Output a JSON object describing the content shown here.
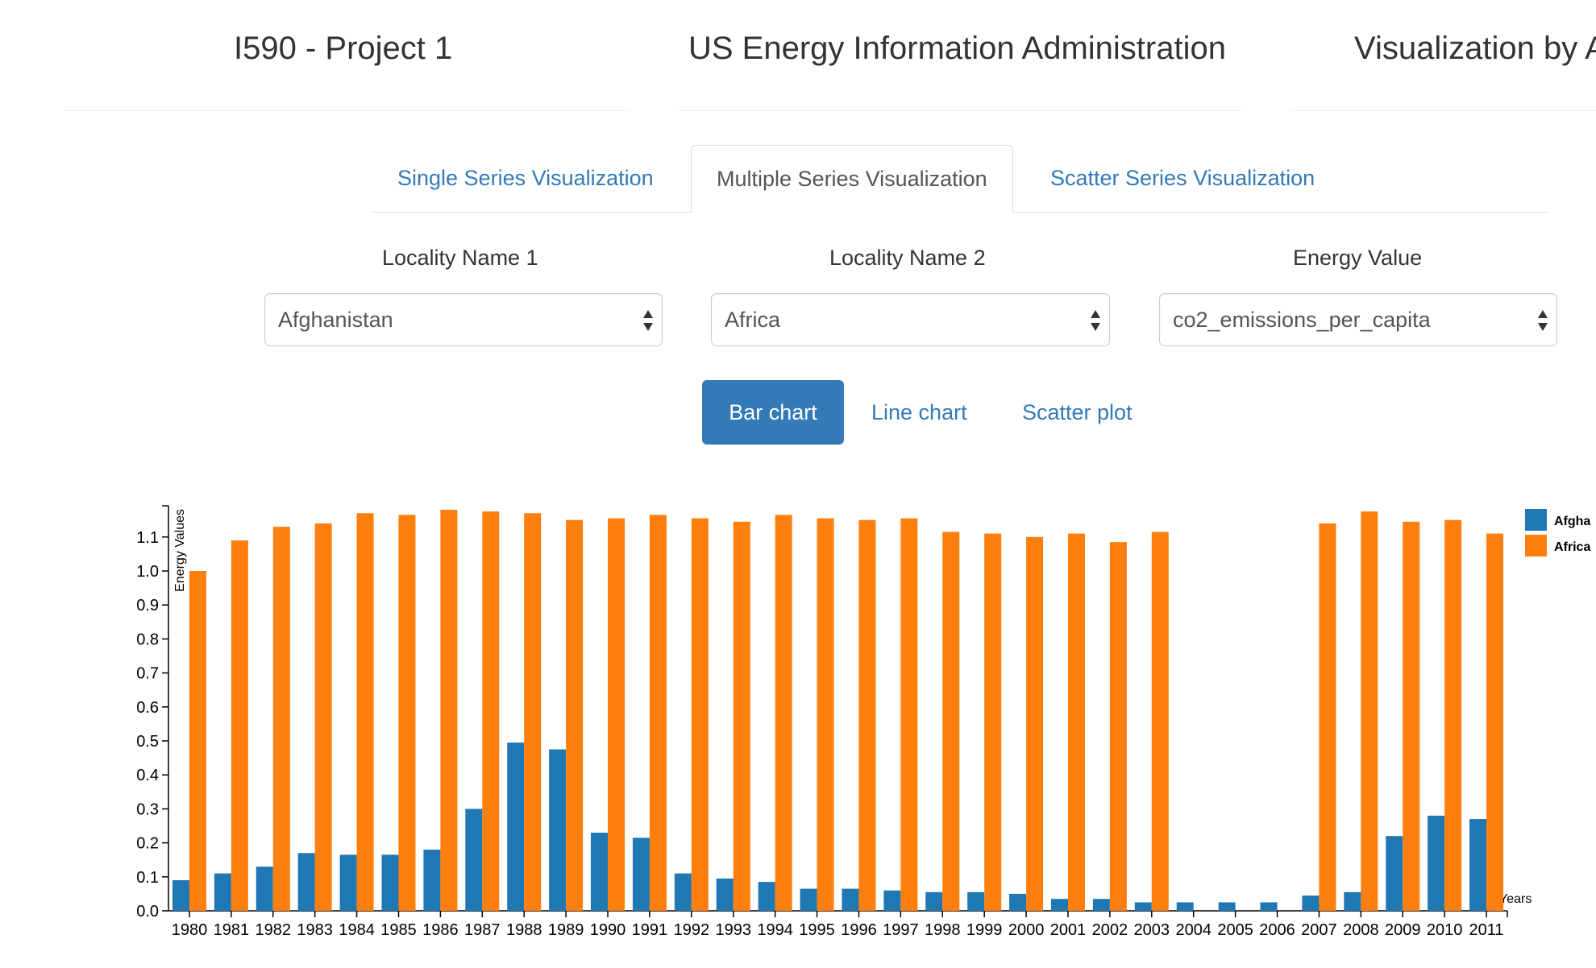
{
  "header": {
    "title_left": "I590 - Project 1",
    "title_center": "US Energy Information Administration",
    "title_right": "Visualization by A"
  },
  "tabs": [
    {
      "label": "Single Series Visualization",
      "active": false
    },
    {
      "label": "Multiple Series Visualization",
      "active": true
    },
    {
      "label": "Scatter Series Visualization",
      "active": false
    }
  ],
  "filters": {
    "locality1": {
      "label": "Locality Name 1",
      "value": "Afghanistan"
    },
    "locality2": {
      "label": "Locality Name 2",
      "value": "Africa"
    },
    "energy": {
      "label": "Energy Value",
      "value": "co2_emissions_per_capita"
    }
  },
  "chart_buttons": {
    "bar": "Bar chart",
    "line": "Line chart",
    "scatter": "Scatter plot"
  },
  "colors": {
    "accent": "#337ab7",
    "series1": "#1f77b4",
    "series2": "#ff7f0e"
  },
  "chart_data": {
    "type": "bar",
    "ylabel": "Energy Values",
    "xlabel": "Years",
    "ylim": [
      0,
      1.18
    ],
    "yticks": [
      "0.0",
      "0.1",
      "0.2",
      "0.3",
      "0.4",
      "0.5",
      "0.6",
      "0.7",
      "0.8",
      "0.9",
      "1.0",
      "1.1"
    ],
    "legend_position": "top-right",
    "categories": [
      "1980",
      "1981",
      "1982",
      "1983",
      "1984",
      "1985",
      "1986",
      "1987",
      "1988",
      "1989",
      "1990",
      "1991",
      "1992",
      "1993",
      "1994",
      "1995",
      "1996",
      "1997",
      "1998",
      "1999",
      "2000",
      "2001",
      "2002",
      "2003",
      "2004",
      "2005",
      "2006",
      "2007",
      "2008",
      "2009",
      "2010",
      "2011"
    ],
    "series": [
      {
        "name": "Afgha",
        "color": "#1f77b4",
        "values": [
          0.09,
          0.11,
          0.13,
          0.17,
          0.165,
          0.165,
          0.18,
          0.3,
          0.495,
          0.475,
          0.23,
          0.215,
          0.11,
          0.095,
          0.085,
          0.065,
          0.065,
          0.06,
          0.055,
          0.055,
          0.05,
          0.035,
          0.035,
          0.025,
          0.025,
          0.025,
          0.025,
          0.045,
          0.055,
          0.22,
          0.28,
          0.27
        ]
      },
      {
        "name": "Africa",
        "color": "#ff7f0e",
        "values": [
          1.0,
          1.09,
          1.13,
          1.14,
          1.17,
          1.165,
          1.18,
          1.175,
          1.17,
          1.15,
          1.155,
          1.165,
          1.155,
          1.145,
          1.165,
          1.155,
          1.15,
          1.155,
          1.115,
          1.11,
          1.1,
          1.11,
          1.085,
          1.115,
          0,
          0,
          0,
          1.14,
          1.175,
          1.145,
          1.15,
          1.11
        ]
      }
    ]
  }
}
